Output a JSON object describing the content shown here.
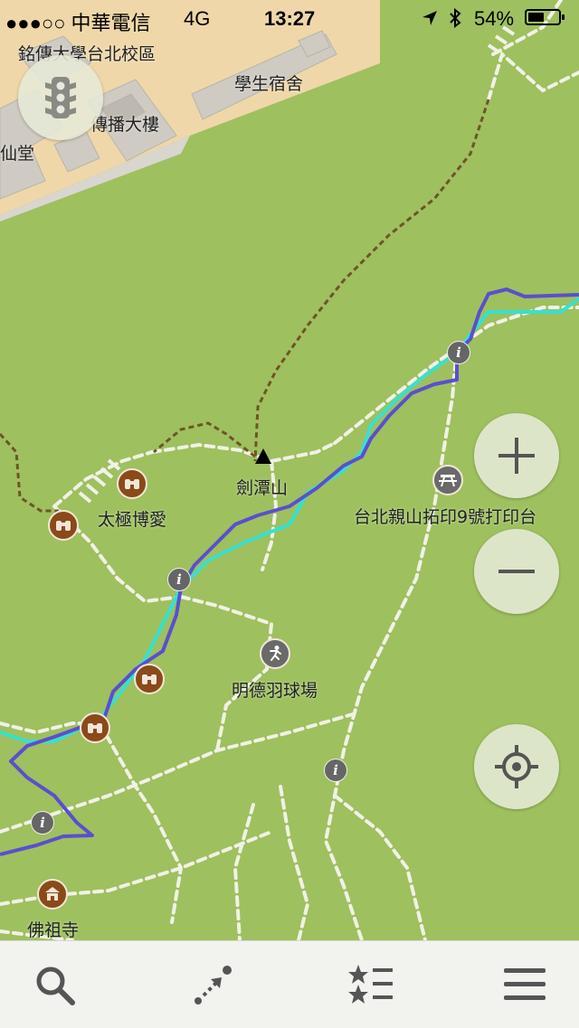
{
  "status_bar": {
    "carrier": "●●●○○ 中華電信",
    "network": "4G",
    "time": "13:27",
    "battery_percent": "54%",
    "battery_level": 0.54
  },
  "map": {
    "colors": {
      "park": "#9ec05f",
      "campus": "#efd7a9",
      "building": "#cfcbc3",
      "track_blue": "#5a4fcf",
      "track_cyan": "#38e0d0",
      "trail_white": "#f1f1e6",
      "path_brown": "#7a5a30",
      "poi_brown": "#8a4a1a"
    },
    "labels": {
      "campus": "銘傳大學台北校區",
      "dorm": "學生宿舍",
      "broadcast": "傳播大樓",
      "xiantang": "仙堂",
      "peak": "劍潭山",
      "taiji": "太極博愛",
      "stamp": "台北親山拓印9號打印台",
      "badminton": "明德羽球場",
      "temple": "佛祖寺"
    },
    "icons": {
      "peak": "peak-triangle-icon",
      "viewpoint": "binoculars-icon",
      "picnic": "picnic-table-icon",
      "sport": "sport-icon",
      "info": "info-icon",
      "temple": "temple-icon"
    },
    "info_glyph": "i"
  },
  "controls": {
    "traffic": "traffic-light-icon",
    "zoom_in": "plus-icon",
    "zoom_out": "minus-icon",
    "locate": "crosshair-icon"
  },
  "bottom_bar": {
    "search": "search-icon",
    "route": "route-icon",
    "bookmarks": "bookmarks-list-icon",
    "menu": "menu-icon"
  }
}
